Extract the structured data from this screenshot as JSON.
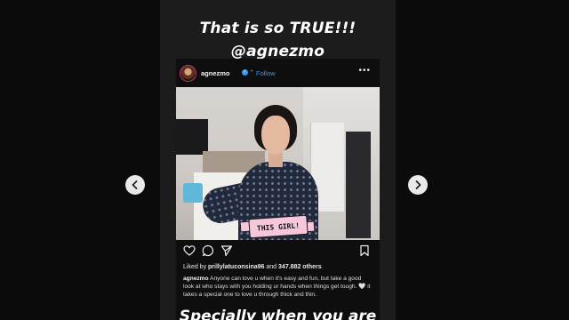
{
  "story": {
    "caption_line1": "That is so TRUE!!!",
    "caption_line2": "@agnezmo",
    "bottom_caption": "Specially when you are"
  },
  "post": {
    "username": "agnezmo",
    "separator": "•",
    "follow_label": "Follow",
    "more_label": "•••",
    "sticker_text": "THIS GIRL!",
    "likes_prefix": "Liked by ",
    "likes_user": "prillylatuconsina96",
    "likes_middle": " and ",
    "likes_count": "347.882 others",
    "caption_user": "agnezmo",
    "caption_body": " Anyone can love u when it's easy and fun, but take a good look at who stays with you holding ur hands when things get tough. 🤍 it takes a special one to love u through thick and thin."
  },
  "icons": {
    "prev": "chevron-left-icon",
    "next": "chevron-right-icon",
    "like": "heart-icon",
    "comment": "comment-icon",
    "share": "share-icon",
    "save": "bookmark-icon",
    "verified": "verified-badge-icon"
  },
  "colors": {
    "background": "#0b0b0b",
    "story_bg": "#1c1c1c",
    "accent_blue": "#3897f0",
    "sticker_pink": "#f6c7da"
  }
}
